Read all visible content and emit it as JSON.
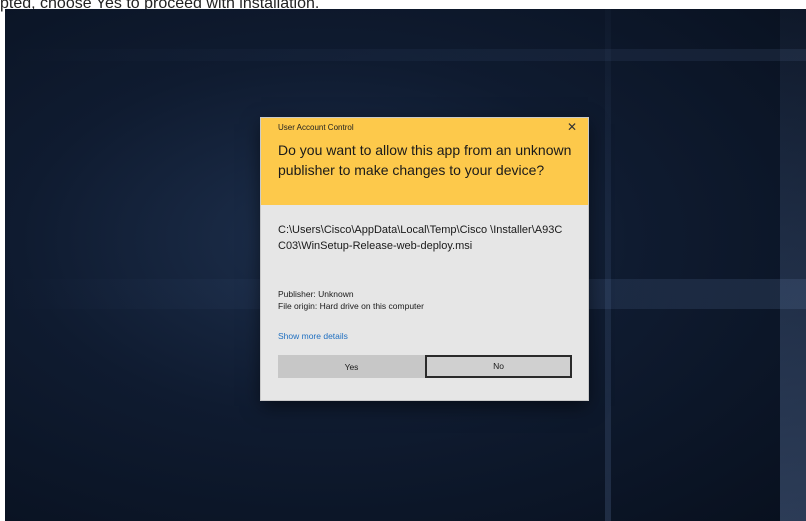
{
  "caption": "pted, choose Yes to proceed with installation.",
  "dialog": {
    "title": "User Account Control",
    "close_glyph": "✕",
    "question": "Do you want to allow this app from an unknown publisher to make changes to your device?",
    "file_path": "C:\\Users\\Cisco\\AppData\\Local\\Temp\\Cisco \\Installer\\A93CC03\\WinSetup-Release-web-deploy.msi",
    "publisher": "Publisher: Unknown",
    "file_origin": "File origin: Hard drive on this computer",
    "show_details": "Show more details",
    "yes_label": "Yes",
    "no_label": "No"
  },
  "colors": {
    "header_bg": "#fdc94b",
    "body_bg": "#e6e6e6",
    "link": "#1f6fc0",
    "desktop": "#0f1b30"
  }
}
